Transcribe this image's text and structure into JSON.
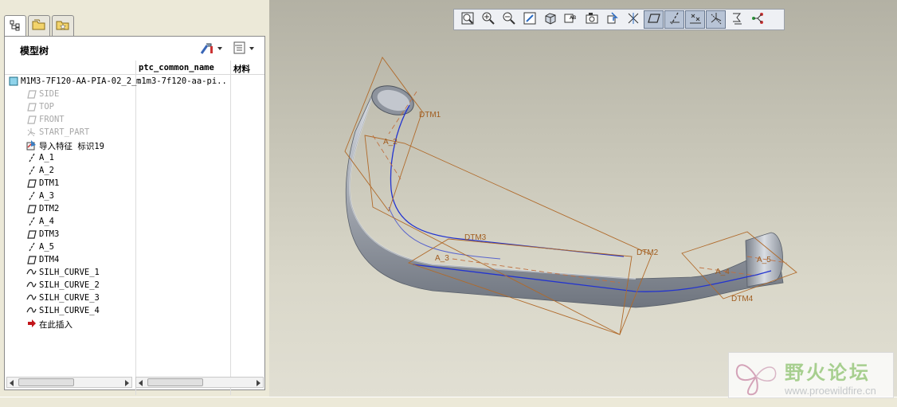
{
  "navigator": {
    "tabs": [
      {
        "name": "model-tree",
        "icon": "model-tree-icon",
        "active": true
      },
      {
        "name": "folder-browser",
        "icon": "folder-icon",
        "active": false
      },
      {
        "name": "favorites",
        "icon": "favorites-folder-icon",
        "active": false
      }
    ]
  },
  "model_tree": {
    "title": "模型树",
    "columns": [
      "ptc_common_name",
      "材料"
    ],
    "root": {
      "label": "M1M3-7F120-AA-PIA-02_2_:",
      "common_name": "m1m3-7f120-aa-pi..."
    },
    "items": [
      {
        "label": "SIDE",
        "icon": "datum-plane-icon",
        "dim": true
      },
      {
        "label": "TOP",
        "icon": "datum-plane-icon",
        "dim": true
      },
      {
        "label": "FRONT",
        "icon": "datum-plane-icon",
        "dim": true
      },
      {
        "label": "START_PART",
        "icon": "csys-icon",
        "dim": true
      },
      {
        "label": "导入特征 标识19",
        "icon": "import-feature-icon",
        "dim": false
      },
      {
        "label": "A_1",
        "icon": "datum-axis-icon",
        "dim": false
      },
      {
        "label": "A_2",
        "icon": "datum-axis-icon",
        "dim": false
      },
      {
        "label": "DTM1",
        "icon": "datum-plane-icon",
        "dim": false
      },
      {
        "label": "A_3",
        "icon": "datum-axis-icon",
        "dim": false
      },
      {
        "label": "DTM2",
        "icon": "datum-plane-icon",
        "dim": false
      },
      {
        "label": "A_4",
        "icon": "datum-axis-icon",
        "dim": false
      },
      {
        "label": "DTM3",
        "icon": "datum-plane-icon",
        "dim": false
      },
      {
        "label": "A_5",
        "icon": "datum-axis-icon",
        "dim": false
      },
      {
        "label": "DTM4",
        "icon": "datum-plane-icon",
        "dim": false
      },
      {
        "label": "SILH_CURVE_1",
        "icon": "curve-icon",
        "dim": false
      },
      {
        "label": "SILH_CURVE_2",
        "icon": "curve-icon",
        "dim": false
      },
      {
        "label": "SILH_CURVE_3",
        "icon": "curve-icon",
        "dim": false
      },
      {
        "label": "SILH_CURVE_4",
        "icon": "curve-icon",
        "dim": false
      },
      {
        "label": "在此插入",
        "icon": "insert-here-arrow-icon",
        "dim": false
      }
    ]
  },
  "view_toolbar": {
    "buttons": [
      {
        "name": "refit",
        "icon": "refit-icon",
        "on": false
      },
      {
        "name": "zoom-in",
        "icon": "zoom-in-icon",
        "on": false
      },
      {
        "name": "zoom-out",
        "icon": "zoom-out-icon",
        "on": false
      },
      {
        "name": "repaint",
        "icon": "repaint-icon",
        "on": false
      },
      {
        "name": "display-style",
        "icon": "display-style-icon",
        "on": false
      },
      {
        "name": "saved-views",
        "icon": "saved-views-icon",
        "on": false
      },
      {
        "name": "view-manager",
        "icon": "view-manager-icon",
        "on": false
      },
      {
        "name": "orient",
        "icon": "orient-icon",
        "on": false
      },
      {
        "name": "spin-center",
        "icon": "spin-center-icon",
        "on": false
      },
      {
        "name": "plane-display",
        "icon": "plane-display-icon",
        "on": true
      },
      {
        "name": "axis-display",
        "icon": "axis-display-icon",
        "on": true
      },
      {
        "name": "point-display",
        "icon": "point-display-icon",
        "on": true
      },
      {
        "name": "csys-display",
        "icon": "csys-display-icon",
        "on": true
      },
      {
        "name": "annotation-display",
        "icon": "annotation-display-icon",
        "on": false
      },
      {
        "name": "manikin",
        "icon": "manikin-icon",
        "on": false
      }
    ]
  },
  "graphics": {
    "datum_labels": [
      "DTM1",
      "A_2",
      "DTM3",
      "A_3",
      "DTM2",
      "A_4",
      "DTM4",
      "A_5"
    ],
    "colors": {
      "datum": "#b06a2a",
      "axis": "#c07040",
      "curve": "#2233d0",
      "pipe": "#9ea3ad"
    }
  },
  "watermark": {
    "title": "野火论坛",
    "url": "www.proewildfire.cn"
  }
}
